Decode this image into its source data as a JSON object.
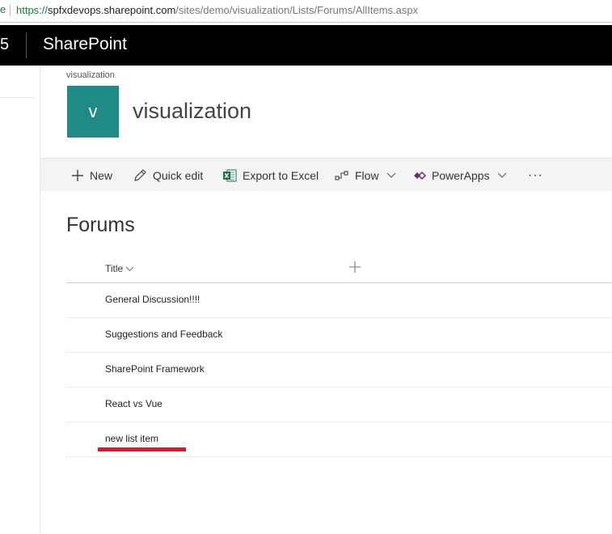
{
  "browser": {
    "lead_char": "e",
    "url_scheme": "https://",
    "url_host": "spfxdevops.sharepoint.com",
    "url_path": "/sites/demo/visualization/Lists/Forums/AllItems.aspx"
  },
  "suite_bar": {
    "partial_text": "5",
    "app_name": "SharePoint"
  },
  "site": {
    "breadcrumb": "visualization",
    "logo_letter": "v",
    "title": "visualization",
    "logo_color": "#1f8a86"
  },
  "command_bar": {
    "new": "New",
    "quick_edit": "Quick edit",
    "export": "Export to Excel",
    "flow": "Flow",
    "powerapps": "PowerApps",
    "more": "···"
  },
  "list": {
    "title": "Forums",
    "column_title": "Title",
    "items": [
      "General Discussion!!!!",
      "Suggestions and Feedback",
      "SharePoint Framework",
      "React vs Vue",
      "new list item"
    ]
  },
  "icons": [
    "plus-icon",
    "pencil-icon",
    "excel-icon",
    "flow-icon",
    "powerapps-icon",
    "chevron-down-icon",
    "more-icon",
    "add-column-icon"
  ],
  "colors": {
    "suite_bar": "#000000",
    "accent_red": "#e0142a",
    "command_bar_bg": "#f4f4f4"
  }
}
